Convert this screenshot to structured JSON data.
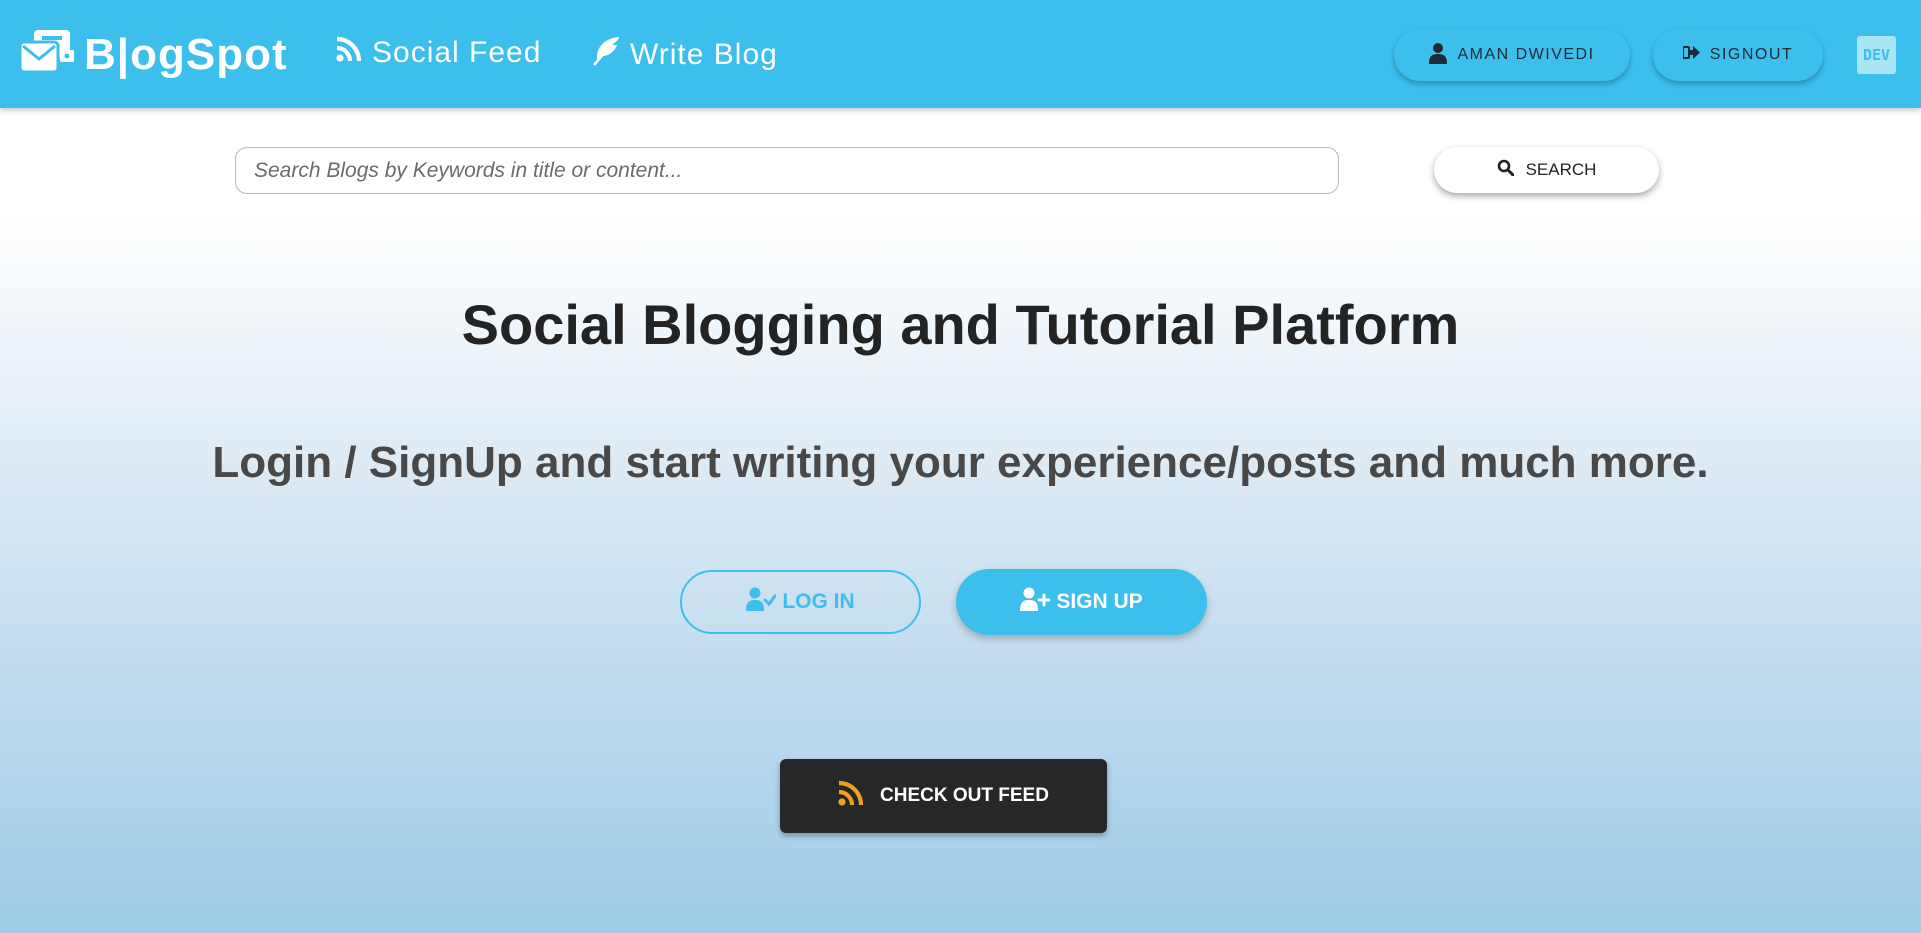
{
  "navbar": {
    "brand": "B|ogSpot",
    "brand_icon": "blog-logo-icon",
    "links": [
      {
        "label": "Social Feed",
        "icon": "rss-icon"
      },
      {
        "label": "Write Blog",
        "icon": "feather-icon"
      }
    ],
    "user_label": "AMAN DWIVEDI",
    "user_icon": "user-icon",
    "signout_label": "SIGNOUT",
    "signout_icon": "sign-out-icon",
    "dev_badge": "DEV"
  },
  "search": {
    "placeholder": "Search Blogs by Keywords in title or content...",
    "value": "",
    "button_label": "SEARCH",
    "button_icon": "search-icon"
  },
  "hero": {
    "title": "Social Blogging and Tutorial Platform",
    "subtitle": "Login / SignUp and start writing your experience/posts and much more."
  },
  "actions": {
    "login_label": "LOG IN",
    "login_icon": "user-check-icon",
    "signup_label": "SIGN UP",
    "signup_icon": "user-plus-icon",
    "feed_label": "CHECK OUT FEED",
    "feed_icon": "rss-icon"
  },
  "colors": {
    "primary": "#3cbfed",
    "dark_button": "#272727",
    "feed_icon": "#f0a020",
    "title_text": "#232323"
  }
}
